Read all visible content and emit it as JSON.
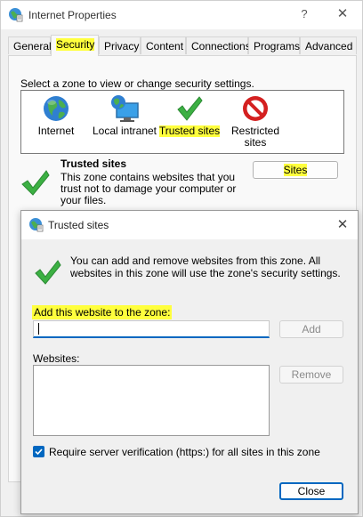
{
  "window": {
    "title": "Internet Properties",
    "help_glyph": "?",
    "close_glyph": "✕"
  },
  "tabs": [
    "General",
    "Security",
    "Privacy",
    "Content",
    "Connections",
    "Programs",
    "Advanced"
  ],
  "active_tab": "Security",
  "security": {
    "zone_prompt": "Select a zone to view or change security settings.",
    "zones": [
      {
        "label": "Internet",
        "icon": "globe-icon"
      },
      {
        "label": "Local intranet",
        "icon": "monitor-globe-icon"
      },
      {
        "label": "Trusted sites",
        "icon": "green-check-icon"
      },
      {
        "label": "Restricted sites",
        "icon": "red-no-entry-icon"
      }
    ],
    "selected_zone_title": "Trusted sites",
    "selected_zone_desc": "This zone contains websites that you trust not to damage your computer or your files.",
    "sites_button": "Sites"
  },
  "dialog": {
    "title": "Trusted sites",
    "close_glyph": "✕",
    "info": "You can add and remove websites from this zone. All websites in this zone will use the zone's security settings.",
    "add_label": "Add this website to the zone:",
    "add_value": "",
    "add_button": "Add",
    "websites_label": "Websites:",
    "websites": [],
    "remove_button": "Remove",
    "require_label": "Require server verification (https:) for all sites in this zone",
    "require_checked": true,
    "close_button": "Close"
  },
  "colors": {
    "highlight": "#ffff3d",
    "accent": "#0067c0",
    "check_green": "#3cb043",
    "restricted_red": "#d42020"
  }
}
